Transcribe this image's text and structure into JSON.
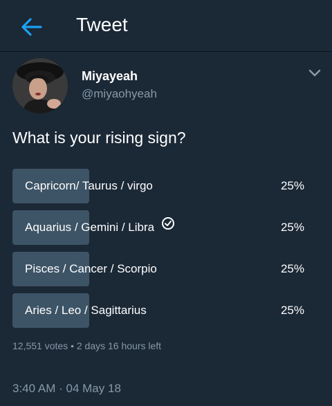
{
  "header": {
    "title": "Tweet",
    "back_icon": "arrow-left-icon",
    "accent_color": "#1da1f2"
  },
  "author": {
    "display_name": "Miyayeah",
    "username": "@miyaohyeah"
  },
  "tweet": {
    "text": "What is your rising sign?"
  },
  "poll": {
    "options": [
      {
        "label": "Capricorn/ Taurus / virgo",
        "percent": "25%",
        "fraction": 0.25,
        "selected": false
      },
      {
        "label": "Aquarius / Gemini / Libra",
        "percent": "25%",
        "fraction": 0.25,
        "selected": true
      },
      {
        "label": "Pisces / Cancer / Scorpio",
        "percent": "25%",
        "fraction": 0.25,
        "selected": false
      },
      {
        "label": "Aries / Leo / Sagittarius",
        "percent": "25%",
        "fraction": 0.25,
        "selected": false
      }
    ],
    "votes": "12,551 votes",
    "separator": "•",
    "time_left": "2 days 16 hours left"
  },
  "timestamp": {
    "time": "3:40 AM",
    "separator": "·",
    "date": "04 May 18"
  },
  "colors": {
    "background": "#1b2836",
    "poll_bar": "#3d5466",
    "secondary_text": "#8899a6"
  }
}
